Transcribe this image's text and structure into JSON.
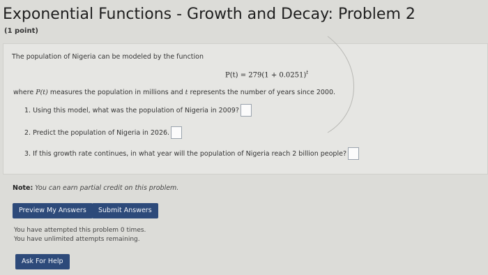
{
  "header": {
    "title": "Exponential Functions - Growth and Decay: Problem 2",
    "points": "(1 point)"
  },
  "problem": {
    "intro": "The population of Nigeria can be modeled by the function",
    "formula_lhs": "P(t) = 279(1 + 0.0251)",
    "formula_exp": "t",
    "where_text_1": "where ",
    "where_var_p": "P(t)",
    "where_text_2": " measures the population in millions and ",
    "where_var_t": "t",
    "where_text_3": " represents the number of years since 2000.",
    "questions": [
      {
        "label": "1. Using this model, what was the population of Nigeria in 2009?",
        "value": ""
      },
      {
        "label": "2. Predict the population of Nigeria in 2026.",
        "value": ""
      },
      {
        "label": "3. If this growth rate continues, in what year will the population of Nigeria reach 2 billion people?",
        "value": ""
      }
    ]
  },
  "note": {
    "bold": "Note:",
    "text": " You can earn partial credit on this problem."
  },
  "buttons": {
    "preview": "Preview My Answers",
    "submit": "Submit Answers",
    "help": "Ask For Help"
  },
  "attempts": {
    "line1": "You have attempted this problem 0 times.",
    "line2": "You have unlimited attempts remaining."
  },
  "colors": {
    "button_bg": "#2d4a7a",
    "page_bg": "#dcdcd8"
  }
}
